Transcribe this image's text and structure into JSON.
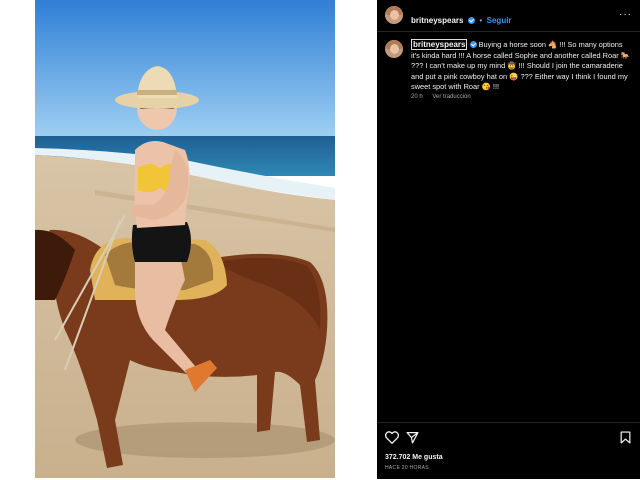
{
  "post": {
    "username": "britneyspears",
    "follow_label": "Seguir",
    "more_label": "···",
    "caption": "Buying a horse soon 🐴 !!! So many options it's kinda hard !!! A horse called Sophie and another called Roar 🐎 ??? I can't make up my mind 🤠 !!! Should I join the camaraderie and put a pink cowboy hat on 😜 ??? Either way I think I found my sweet spot with Roar 😘 !!!",
    "age": "20 h",
    "translate_label": "Ver traducción",
    "likes": "372.702 Me gusta",
    "timestamp": "HACE 20 HORAS"
  },
  "colors": {
    "panel_bg": "#000000",
    "accent": "#3897f0",
    "secondary_text": "#a8a8a8"
  },
  "icons": [
    "heart-icon",
    "share-icon",
    "bookmark-icon",
    "verified-badge-icon"
  ]
}
